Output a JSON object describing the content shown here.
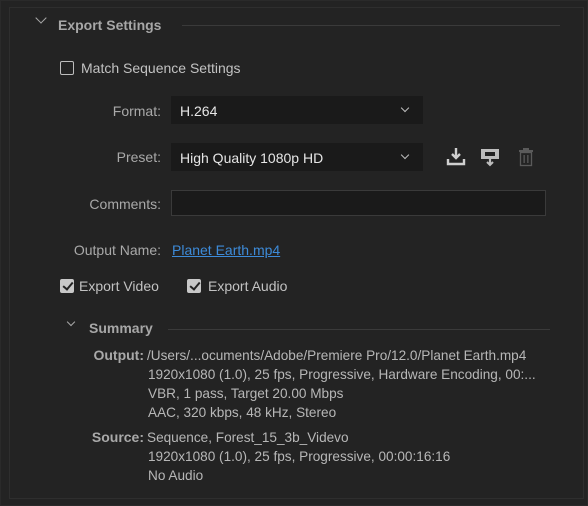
{
  "export_settings": {
    "title": "Export Settings",
    "match_sequence": {
      "label": "Match Sequence Settings",
      "checked": false
    },
    "format": {
      "label": "Format:",
      "value": "H.264"
    },
    "preset": {
      "label": "Preset:",
      "value": "High Quality 1080p HD"
    },
    "comments": {
      "label": "Comments:",
      "value": ""
    },
    "output_name": {
      "label": "Output Name:",
      "value": "Planet Earth.mp4"
    },
    "export_video": {
      "label": "Export Video",
      "checked": true
    },
    "export_audio": {
      "label": "Export Audio",
      "checked": true
    }
  },
  "summary": {
    "title": "Summary",
    "output_label": "Output:",
    "output_lines": [
      "/Users/...ocuments/Adobe/Premiere Pro/12.0/Planet Earth.mp4",
      "1920x1080 (1.0), 25 fps, Progressive, Hardware Encoding, 00:...",
      "VBR, 1 pass, Target 20.00 Mbps",
      "AAC, 320 kbps, 48 kHz, Stereo"
    ],
    "source_label": "Source:",
    "source_lines": [
      "Sequence, Forest_15_3b_Videvo",
      "1920x1080 (1.0), 25 fps, Progressive, 00:00:16:16",
      "No Audio"
    ]
  },
  "icons": {
    "save_preset": "download-icon",
    "import_preset": "import-icon",
    "delete_preset": "trash-icon"
  },
  "colors": {
    "background": "#232323",
    "field": "#1a1a1a",
    "link": "#3d8bd9",
    "text": "#bdbdbd"
  }
}
